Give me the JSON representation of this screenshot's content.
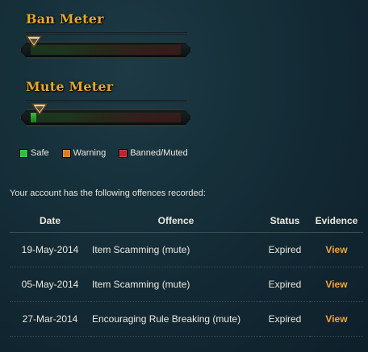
{
  "colors": {
    "title": "#e7a62b",
    "safe": "#2fbf3a",
    "warning": "#e07b1c",
    "banned": "#c8202c",
    "link": "#f0a533"
  },
  "ban_meter": {
    "title": "Ban Meter",
    "level": 0.0
  },
  "mute_meter": {
    "title": "Mute Meter",
    "level": 0.04
  },
  "legend": [
    {
      "label": "Safe",
      "color": "#2fbf3a"
    },
    {
      "label": "Warning",
      "color": "#e07b1c"
    },
    {
      "label": "Banned/Muted",
      "color": "#c8202c"
    }
  ],
  "intro_text": "Your account has the following offences recorded:",
  "table": {
    "headers": {
      "date": "Date",
      "offence": "Offence",
      "status": "Status",
      "evidence": "Evidence"
    },
    "rows": [
      {
        "date": "19-May-2014",
        "offence": "Item Scamming (mute)",
        "status": "Expired",
        "evidence": "View"
      },
      {
        "date": "05-May-2014",
        "offence": "Item Scamming (mute)",
        "status": "Expired",
        "evidence": "View"
      },
      {
        "date": "27-Mar-2014",
        "offence": "Encouraging Rule Breaking (mute)",
        "status": "Expired",
        "evidence": "View"
      }
    ]
  }
}
